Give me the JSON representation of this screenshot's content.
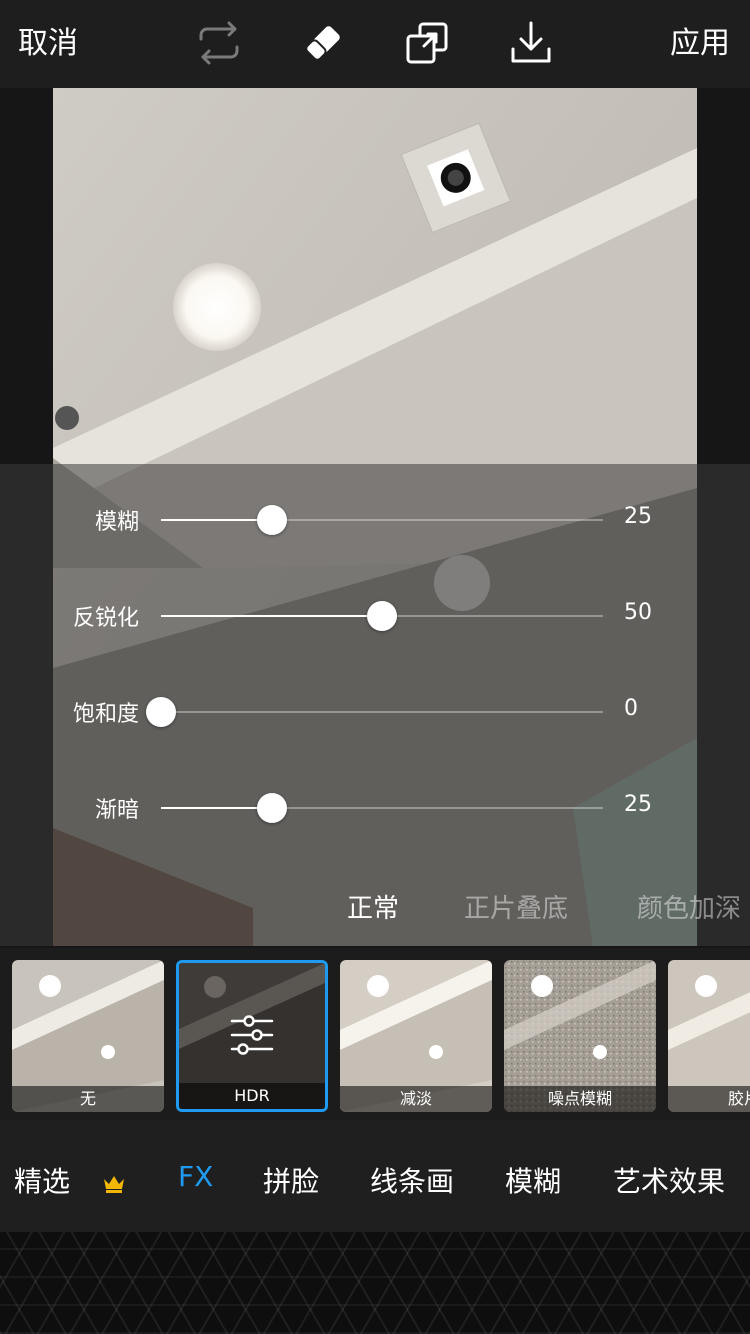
{
  "topbar": {
    "cancel_label": "取消",
    "apply_label": "应用",
    "icons": [
      "swap-icon",
      "eraser-icon",
      "compare-icon",
      "download-icon"
    ]
  },
  "sliders": [
    {
      "label": "模糊",
      "value": "25",
      "level": 0.25
    },
    {
      "label": "反锐化",
      "value": "50",
      "level": 0.5
    },
    {
      "label": "饱和度",
      "value": "0",
      "level": 0.0
    },
    {
      "label": "渐暗",
      "value": "25",
      "level": 0.25
    }
  ],
  "blend_modes": [
    {
      "label": "正常",
      "active": true
    },
    {
      "label": "正片叠底",
      "active": false
    },
    {
      "label": "颜色加深",
      "active": false
    }
  ],
  "filters": [
    {
      "label": "无",
      "selected": false
    },
    {
      "label": "HDR",
      "selected": true
    },
    {
      "label": "减淡",
      "selected": false
    },
    {
      "label": "噪点模糊",
      "selected": false
    },
    {
      "label": "胶片",
      "selected": false
    }
  ],
  "tabs": [
    {
      "label": "精选",
      "active": false,
      "badge": "crown-icon"
    },
    {
      "label": "FX",
      "active": true
    },
    {
      "label": "拼脸",
      "active": false
    },
    {
      "label": "线条画",
      "active": false
    },
    {
      "label": "模糊",
      "active": false
    },
    {
      "label": "艺术效果",
      "active": false
    }
  ],
  "colors": {
    "accent": "#1e9bf0",
    "crown": "#f2b705"
  }
}
